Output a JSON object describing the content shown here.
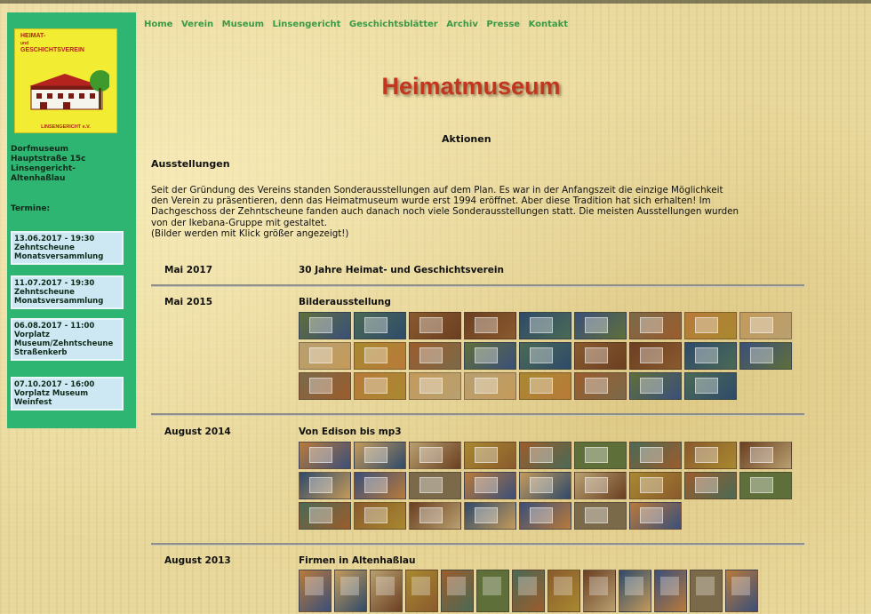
{
  "nav": [
    "Home",
    "Verein",
    "Museum",
    "Linsengericht",
    "Geschichtsblätter",
    "Archiv",
    "Presse",
    "Kontakt"
  ],
  "sidebar": {
    "logo_line1": "HEIMAT-",
    "logo_line2": "und",
    "logo_line3": "GESCHICHTSVEREIN",
    "logo_bottom": "LINSENGERICHT e.V.",
    "address": [
      "Dorfmuseum",
      "Hauptstraße 15c",
      "Linsengericht-",
      "Altenhaßlau"
    ],
    "termine_label": "Termine:",
    "termine": [
      {
        "l1": "13.06.2017 - 19:30",
        "l2": "Zehntscheune",
        "l3": "Monatsversammlung"
      },
      {
        "l1": "11.07.2017 - 19:30",
        "l2": "Zehntscheune",
        "l3": "Monatsversammlung"
      },
      {
        "l1": "06.08.2017 - 11:00",
        "l2": "Vorplatz",
        "l3": "Museum/Zehntscheune",
        "l4": "Straßenkerb"
      },
      {
        "l1": "07.10.2017 - 16:00",
        "l2": "Vorplatz Museum",
        "l3": "Weinfest"
      }
    ]
  },
  "main": {
    "title": "Heimatmuseum",
    "aktionen": "Aktionen",
    "section": "Ausstellungen",
    "intro": [
      "Seit der Gründung des Vereins standen Sonderausstellungen auf dem Plan. Es war in der Anfangszeit die einzige Möglichkeit",
      "den Verein zu präsentieren, denn das Heimatmuseum wurde erst 1994 eröffnet. Aber diese Tradition hat sich erhalten! Im",
      "Dachgeschoss der Zehntscheune fanden auch danach noch viele Sonderausstellungen statt. Die meisten Ausstellungen wurden",
      "von der Ikebana-Gruppe mit gestaltet.",
      "(Bilder werden mit Klick größer angezeigt!)"
    ],
    "exhibitions": [
      {
        "date": "Mai 2017",
        "title": "30 Jahre Heimat- und Geschichtsverein"
      },
      {
        "date": "Mai 2015",
        "title": "Bilderausstellung"
      },
      {
        "date": "August 2014",
        "title": "Von Edison bis mp3"
      },
      {
        "date": "August 2013",
        "title": "Firmen in Altenhaßlau"
      }
    ]
  },
  "colors": {
    "sidebar": "#2fb572",
    "nav": "#3a9a45",
    "title": "#c2351e",
    "termin_box": "#cde8f2"
  }
}
